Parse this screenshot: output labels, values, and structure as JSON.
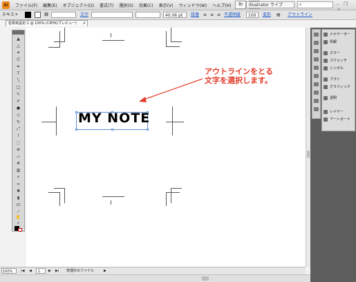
{
  "menubar": {
    "app_icon": "Ai",
    "items": [
      "ファイル(F)",
      "編集(E)",
      "オブジェクト(O)",
      "書式(T)",
      "選択(S)",
      "効果(C)",
      "表示(V)",
      "ウィンドウ(W)",
      "ヘルプ(H)"
    ],
    "workspace": "Illustrator ライブ",
    "window_controls": "– ❐ ×"
  },
  "controlbar": {
    "selection_label": "テキスト",
    "stroke_label": "線",
    "char_label": "文字",
    "size_value": "40.06 pt",
    "para_label": "段落",
    "opacity_label": "不透明度",
    "opacity_value": "100",
    "transform_label": "変形",
    "outline_label": "アウトライン",
    "colors": {
      "fill": "#000000",
      "stroke": "#ffffff"
    }
  },
  "document_tab": {
    "title": "名称未設定-1 @ 100% (CMYK/プレビュー)",
    "close": "×"
  },
  "canvas": {
    "title_text": "MY NOTE",
    "annotation_line1": "アウトラインをとる",
    "annotation_line2": "文字を選択します。",
    "annotation_color": "#e23b2a",
    "selection_color": "#5f8fd6"
  },
  "panels": {
    "labels": [
      "ナビゲーター",
      "情報",
      "カラー",
      "スウォッチ",
      "シンボル",
      "ブラシ",
      "グラフィック",
      "透明",
      "レイヤー",
      "アートボード"
    ]
  },
  "statusbar": {
    "zoom": "100%",
    "page": "1",
    "status": "管理外のファイル"
  }
}
